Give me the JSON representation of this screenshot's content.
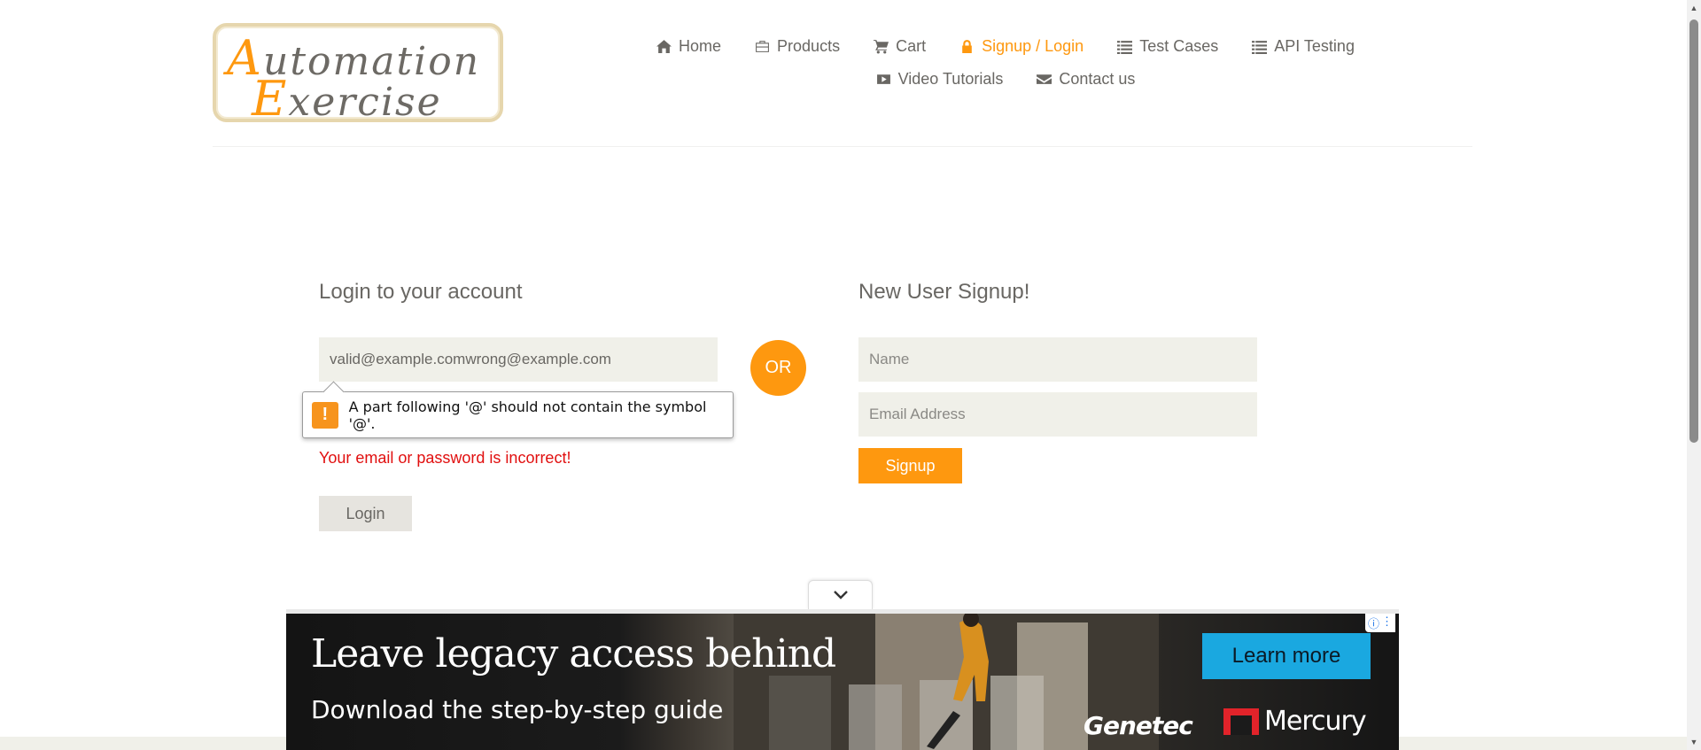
{
  "logo": {
    "line1_cap": "A",
    "line1_rest": "utomation",
    "line2_cap": "E",
    "line2_rest": "xercise"
  },
  "nav": {
    "row1": [
      {
        "label": "Home",
        "icon": "home-icon"
      },
      {
        "label": "Products",
        "icon": "briefcase-icon"
      },
      {
        "label": "Cart",
        "icon": "cart-icon"
      },
      {
        "label": "Signup / Login",
        "icon": "lock-icon",
        "active": true
      },
      {
        "label": "Test Cases",
        "icon": "list-icon"
      },
      {
        "label": "API Testing",
        "icon": "list-icon"
      }
    ],
    "row2": [
      {
        "label": "Video Tutorials",
        "icon": "youtube-play-icon"
      },
      {
        "label": "Contact us",
        "icon": "envelope-icon"
      }
    ]
  },
  "login": {
    "title": "Login to your account",
    "email_value": "valid@example.comwrong@example.com",
    "validation_message": "A part following '@' should not contain the symbol '@'.",
    "error": "Your email or password is incorrect!",
    "button": "Login"
  },
  "or_label": "OR",
  "signup": {
    "title": "New User Signup!",
    "name_placeholder": "Name",
    "email_placeholder": "Email Address",
    "button": "Signup"
  },
  "ad": {
    "headline": "Leave legacy access behind",
    "subline": "Download the step-by-step guide",
    "cta": "Learn more",
    "brand1": "Genetec",
    "brand2": "Mercury"
  },
  "colors": {
    "accent": "#fe980f",
    "field_bg": "#f0f0e9",
    "error": "#e10f0f",
    "text": "#696763"
  }
}
